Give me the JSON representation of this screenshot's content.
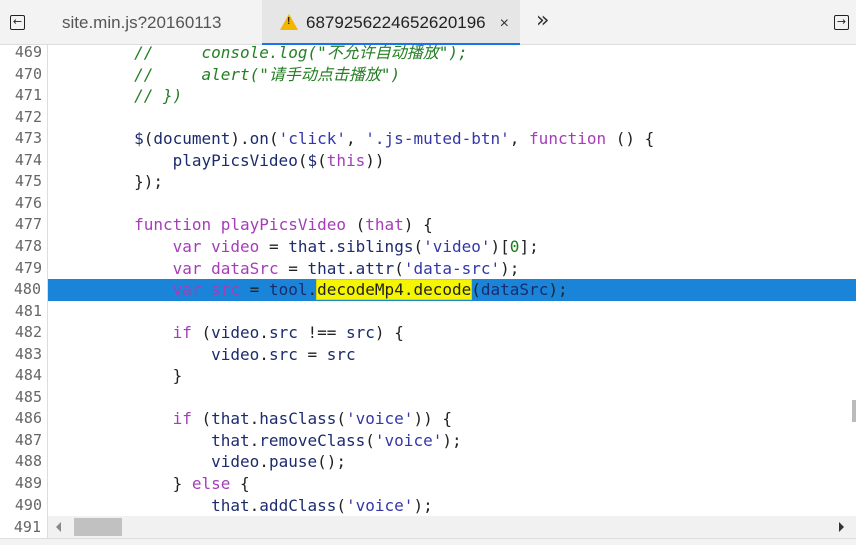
{
  "tabs": [
    {
      "label": "site.min.js?20160113",
      "active": false
    },
    {
      "label": "6879256224652620196",
      "active": true,
      "icon": "warning-icon",
      "close": "×"
    }
  ],
  "more_tabs": "»",
  "highlight_color": "#1a84d8",
  "lines": [
    {
      "n": "469",
      "tokens": [
        [
          "cm",
          "        //     console.log(\"不允许自动播放\");"
        ]
      ]
    },
    {
      "n": "470",
      "tokens": [
        [
          "cm",
          "        //     alert(\"请手动点击播放\")"
        ]
      ]
    },
    {
      "n": "471",
      "tokens": [
        [
          "cm",
          "        // })"
        ]
      ]
    },
    {
      "n": "472",
      "tokens": []
    },
    {
      "n": "473",
      "tokens": [
        [
          "p",
          "        "
        ],
        [
          "id",
          "$"
        ],
        [
          "p",
          "("
        ],
        [
          "id",
          "document"
        ],
        [
          "p",
          ")."
        ],
        [
          "id",
          "on"
        ],
        [
          "p",
          "("
        ],
        [
          "str",
          "'click'"
        ],
        [
          "p",
          ", "
        ],
        [
          "str",
          "'.js-muted-btn'"
        ],
        [
          "p",
          ", "
        ],
        [
          "kw",
          "function"
        ],
        [
          "p",
          " () {"
        ]
      ]
    },
    {
      "n": "474",
      "tokens": [
        [
          "p",
          "            "
        ],
        [
          "id",
          "playPicsVideo"
        ],
        [
          "p",
          "("
        ],
        [
          "id",
          "$"
        ],
        [
          "p",
          "("
        ],
        [
          "kw",
          "this"
        ],
        [
          "p",
          "))"
        ]
      ]
    },
    {
      "n": "475",
      "tokens": [
        [
          "p",
          "        });"
        ]
      ]
    },
    {
      "n": "476",
      "tokens": []
    },
    {
      "n": "477",
      "tokens": [
        [
          "p",
          "        "
        ],
        [
          "kw",
          "function"
        ],
        [
          "p",
          " "
        ],
        [
          "kw",
          "playPicsVideo"
        ],
        [
          "p",
          " ("
        ],
        [
          "kw",
          "that"
        ],
        [
          "p",
          ") {"
        ]
      ]
    },
    {
      "n": "478",
      "tokens": [
        [
          "p",
          "            "
        ],
        [
          "kw",
          "var"
        ],
        [
          "p",
          " "
        ],
        [
          "kw",
          "video"
        ],
        [
          "p",
          " = "
        ],
        [
          "id",
          "that"
        ],
        [
          "p",
          "."
        ],
        [
          "id",
          "siblings"
        ],
        [
          "p",
          "("
        ],
        [
          "str",
          "'video'"
        ],
        [
          "p",
          ")["
        ],
        [
          "num",
          "0"
        ],
        [
          "p",
          "];"
        ]
      ]
    },
    {
      "n": "479",
      "tokens": [
        [
          "p",
          "            "
        ],
        [
          "kw",
          "var"
        ],
        [
          "p",
          " "
        ],
        [
          "kw",
          "dataSrc"
        ],
        [
          "p",
          " = "
        ],
        [
          "id",
          "that"
        ],
        [
          "p",
          "."
        ],
        [
          "id",
          "attr"
        ],
        [
          "p",
          "("
        ],
        [
          "str",
          "'data-src'"
        ],
        [
          "p",
          ");"
        ]
      ]
    },
    {
      "n": "480",
      "highlight": true,
      "tokens": [
        [
          "p",
          "            "
        ],
        [
          "kw",
          "var"
        ],
        [
          "p",
          " "
        ],
        [
          "kw",
          "src"
        ],
        [
          "p",
          " = "
        ],
        [
          "id",
          "tool"
        ],
        [
          "p",
          "."
        ],
        [
          "mark",
          "decodeMp4.decode"
        ],
        [
          "p",
          "("
        ],
        [
          "id",
          "dataSrc"
        ],
        [
          "p",
          ");"
        ]
      ]
    },
    {
      "n": "481",
      "tokens": []
    },
    {
      "n": "482",
      "tokens": [
        [
          "p",
          "            "
        ],
        [
          "kw",
          "if"
        ],
        [
          "p",
          " ("
        ],
        [
          "id",
          "video"
        ],
        [
          "p",
          "."
        ],
        [
          "id",
          "src"
        ],
        [
          "p",
          " !== "
        ],
        [
          "id",
          "src"
        ],
        [
          "p",
          ") {"
        ]
      ]
    },
    {
      "n": "483",
      "tokens": [
        [
          "p",
          "                "
        ],
        [
          "id",
          "video"
        ],
        [
          "p",
          "."
        ],
        [
          "id",
          "src"
        ],
        [
          "p",
          " = "
        ],
        [
          "id",
          "src"
        ]
      ]
    },
    {
      "n": "484",
      "tokens": [
        [
          "p",
          "            }"
        ]
      ]
    },
    {
      "n": "485",
      "tokens": []
    },
    {
      "n": "486",
      "tokens": [
        [
          "p",
          "            "
        ],
        [
          "kw",
          "if"
        ],
        [
          "p",
          " ("
        ],
        [
          "id",
          "that"
        ],
        [
          "p",
          "."
        ],
        [
          "id",
          "hasClass"
        ],
        [
          "p",
          "("
        ],
        [
          "str",
          "'voice'"
        ],
        [
          "p",
          ")) {"
        ]
      ]
    },
    {
      "n": "487",
      "tokens": [
        [
          "p",
          "                "
        ],
        [
          "id",
          "that"
        ],
        [
          "p",
          "."
        ],
        [
          "id",
          "removeClass"
        ],
        [
          "p",
          "("
        ],
        [
          "str",
          "'voice'"
        ],
        [
          "p",
          ");"
        ]
      ]
    },
    {
      "n": "488",
      "tokens": [
        [
          "p",
          "                "
        ],
        [
          "id",
          "video"
        ],
        [
          "p",
          "."
        ],
        [
          "id",
          "pause"
        ],
        [
          "p",
          "();"
        ]
      ]
    },
    {
      "n": "489",
      "tokens": [
        [
          "p",
          "            } "
        ],
        [
          "kw",
          "else"
        ],
        [
          "p",
          " {"
        ]
      ]
    },
    {
      "n": "490",
      "tokens": [
        [
          "p",
          "                "
        ],
        [
          "id",
          "that"
        ],
        [
          "p",
          "."
        ],
        [
          "id",
          "addClass"
        ],
        [
          "p",
          "("
        ],
        [
          "str",
          "'voice'"
        ],
        [
          "p",
          ");"
        ]
      ]
    }
  ],
  "last_line_number": "491"
}
